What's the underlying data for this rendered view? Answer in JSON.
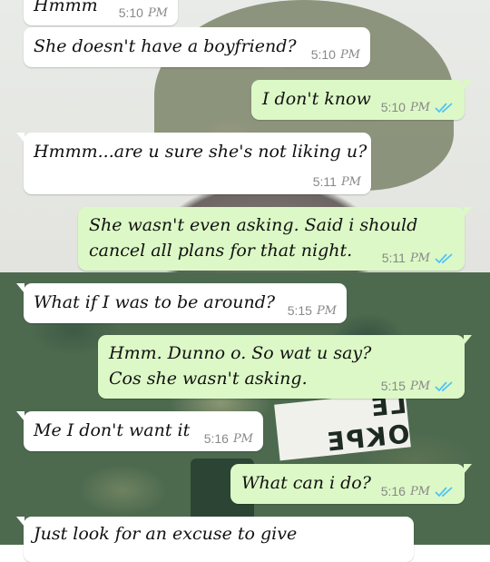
{
  "colors": {
    "incoming_bubble": "#ffffff",
    "outgoing_bubble": "#dcf8c6",
    "read_tick": "#4fc3f7",
    "time_text": "#888888"
  },
  "wallpaper": {
    "name_tag_text": "LE OKPE"
  },
  "messages": [
    {
      "direction": "in",
      "text": "Hmmm",
      "time": "5:10",
      "ampm": "PM"
    },
    {
      "direction": "in",
      "text": "She doesn't have a boyfriend?",
      "time": "5:10",
      "ampm": "PM"
    },
    {
      "direction": "out",
      "text": "I don't know",
      "time": "5:10",
      "ampm": "PM",
      "status": "read"
    },
    {
      "direction": "in",
      "text": "Hmmm...are u sure she's not liking u?",
      "time": "5:11",
      "ampm": "PM"
    },
    {
      "direction": "out",
      "lines": [
        "She wasn't even asking. Said i should",
        "cancel all plans for that night."
      ],
      "time": "5:11",
      "ampm": "PM",
      "status": "read"
    },
    {
      "direction": "in",
      "text": "What if I was to be around?",
      "time": "5:15",
      "ampm": "PM"
    },
    {
      "direction": "out",
      "lines": [
        "Hmm. Dunno o. So wat u say?",
        "Cos she wasn't asking."
      ],
      "time": "5:15",
      "ampm": "PM",
      "status": "read"
    },
    {
      "direction": "in",
      "text": "Me I don't want it",
      "time": "5:16",
      "ampm": "PM"
    },
    {
      "direction": "out",
      "text": "What can i do?",
      "time": "5:16",
      "ampm": "PM",
      "status": "read"
    },
    {
      "direction": "in",
      "text": "Just look for an excuse to give",
      "time": "",
      "ampm": ""
    }
  ]
}
